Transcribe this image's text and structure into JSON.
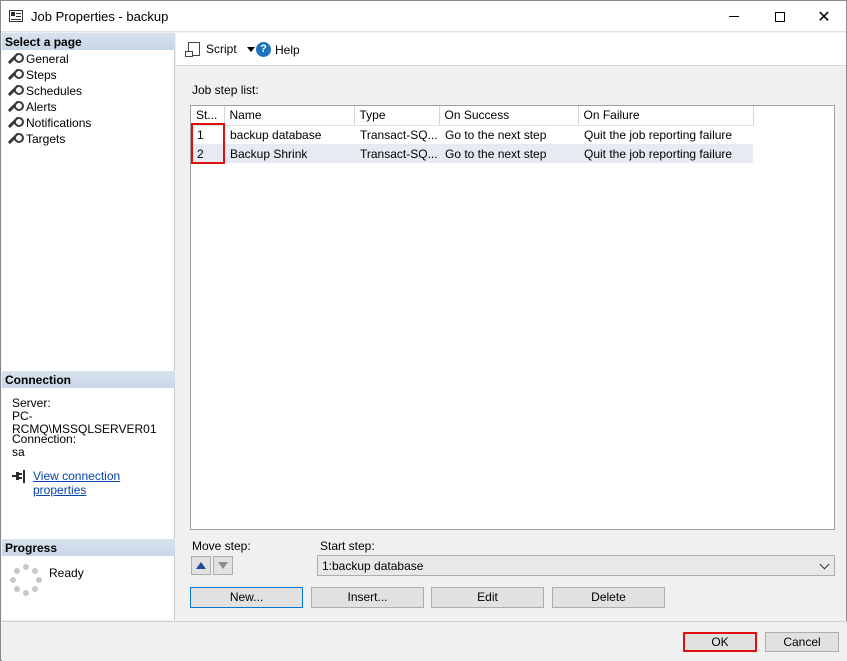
{
  "window": {
    "title": "Job Properties - backup",
    "minimize_glyph": "",
    "close_glyph": "✕"
  },
  "left_pane": {
    "select_page_header": "Select a page",
    "pages": [
      {
        "label": "General",
        "icon": "wrench-icon"
      },
      {
        "label": "Steps",
        "icon": "wrench-icon"
      },
      {
        "label": "Schedules",
        "icon": "wrench-icon"
      },
      {
        "label": "Alerts",
        "icon": "wrench-icon"
      },
      {
        "label": "Notifications",
        "icon": "wrench-icon"
      },
      {
        "label": "Targets",
        "icon": "wrench-icon"
      }
    ],
    "connection_header": "Connection",
    "server_label": "Server:",
    "server_value": "PC-RCMQ\\MSSQLSERVER01",
    "connection_label": "Connection:",
    "connection_value": "sa",
    "view_connection_link": "View connection properties",
    "progress_header": "Progress",
    "progress_status": "Ready"
  },
  "toolbar": {
    "script_label": "Script",
    "help_label": "Help",
    "help_glyph": "?"
  },
  "main": {
    "job_step_list_label": "Job step list:",
    "columns": [
      "St...",
      "Name",
      "Type",
      "On Success",
      "On Failure"
    ],
    "rows": [
      {
        "step": "1",
        "name": "backup database",
        "type": "Transact-SQ...",
        "on_success": "Go to the next step",
        "on_failure": "Quit the job reporting failure"
      },
      {
        "step": "2",
        "name": "Backup Shrink",
        "type": "Transact-SQ...",
        "on_success": "Go to the next step",
        "on_failure": "Quit the job reporting failure"
      }
    ],
    "move_step_label": "Move step:",
    "start_step_label": "Start step:",
    "start_step_value": "1:backup database",
    "buttons": {
      "new": "New...",
      "insert": "Insert...",
      "edit": "Edit",
      "delete": "Delete"
    }
  },
  "footer": {
    "ok": "OK",
    "cancel": "Cancel"
  },
  "colors": {
    "highlight": "#e01010",
    "link": "#0645ad",
    "section_header": "#c9d6e6"
  }
}
